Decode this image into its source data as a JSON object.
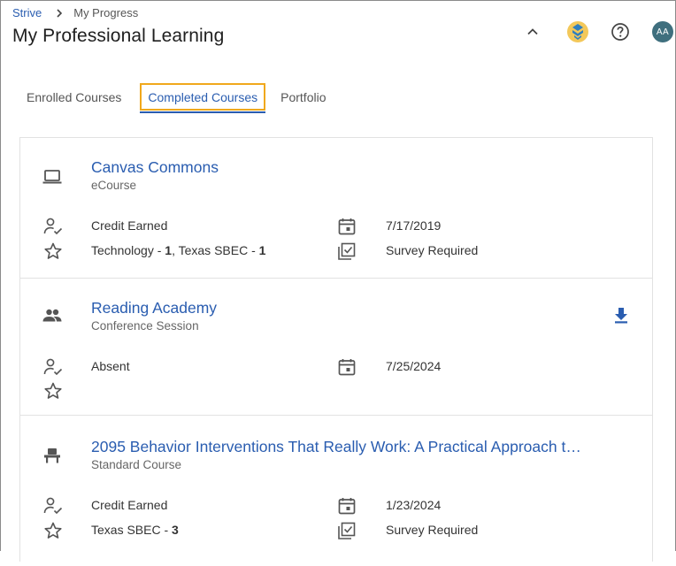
{
  "breadcrumb": {
    "root": "Strive",
    "current": "My Progress"
  },
  "page": {
    "title": "My Professional Learning"
  },
  "header": {
    "avatar_initials": "AA"
  },
  "tabs": [
    {
      "label": "Enrolled Courses",
      "active": false
    },
    {
      "label": "Completed Courses",
      "active": true
    },
    {
      "label": "Portfolio",
      "active": false
    }
  ],
  "courses": [
    {
      "title": "Canvas Commons",
      "type": "eCourse",
      "type_icon": "laptop-icon",
      "status": "Credit Earned",
      "date": "7/17/2019",
      "credits": [
        {
          "name": "Technology",
          "sep": " - ",
          "value": "1"
        },
        {
          "name": ", Texas SBEC",
          "sep": " - ",
          "value": "1"
        }
      ],
      "survey": "Survey Required"
    },
    {
      "title": "Reading Academy",
      "type": "Conference Session",
      "type_icon": "group-icon",
      "status": "Absent",
      "date": "7/25/2024",
      "download_icon": "download-icon"
    },
    {
      "title": "2095 Behavior Interventions That Really Work: A Practical Approach t…",
      "type": "Standard Course",
      "type_icon": "classroom-desk-icon",
      "status": "Credit Earned",
      "date": "1/23/2024",
      "credits": [
        {
          "name": "Texas SBEC",
          "sep": " - ",
          "value": "3"
        }
      ],
      "survey": "Survey Required"
    }
  ],
  "colors": {
    "link": "#2a5db0",
    "tab_focus": "#f0a81c",
    "avatar_bg": "#3f6f7e"
  }
}
